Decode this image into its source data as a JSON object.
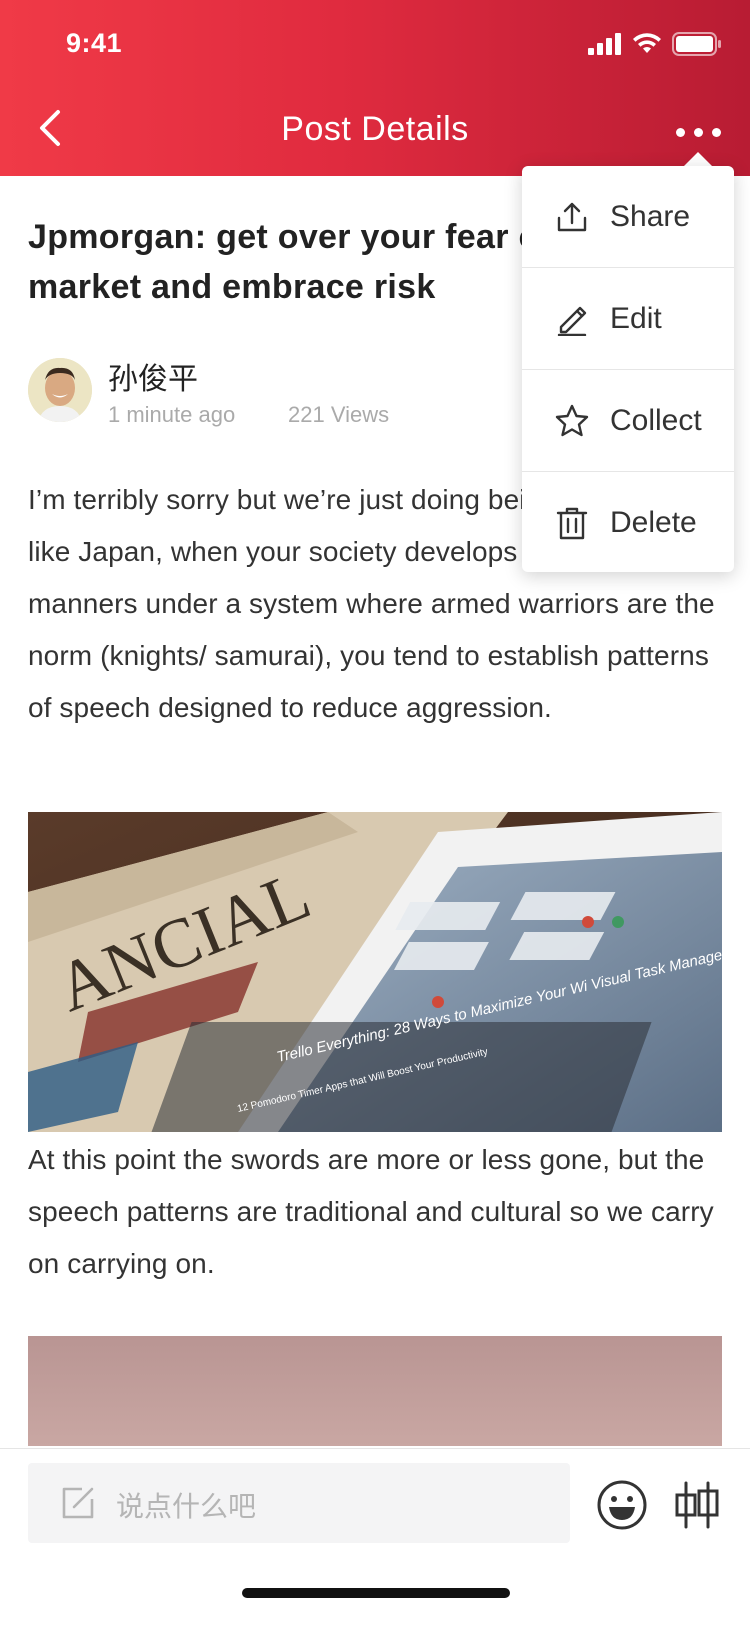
{
  "status_bar": {
    "time": "9:41"
  },
  "nav": {
    "title": "Post Details"
  },
  "post": {
    "title": "Jpmorgan: get over your fear of the stock market and embrace risk",
    "author": "孙俊平",
    "time_ago": "1 minute ago",
    "views": "221 Views",
    "paragraph_1": "I’m terribly sorry but we’re just doing being polite. Much like Japan, when your society develops it’s sense of manners under a system where armed warriors are the norm (knights/ samurai), you tend to establish patterns of speech designed to reduce aggression.",
    "paragraph_2": "At this point the swords are more or less gone, but the speech patterns are traditional and cultural so we carry on carrying on.",
    "image_1": {
      "newspaper_text": "ANCIAL",
      "screen_headline": "Trello Everything: 28 Ways to Maximize Your Wi Visual Task Management Tool",
      "screen_byline": "12 Pomodoro Timer Apps that Will Boost Your Productivity"
    }
  },
  "menu": {
    "items": [
      {
        "label": "Share",
        "icon": "share-icon"
      },
      {
        "label": "Edit",
        "icon": "edit-icon"
      },
      {
        "label": "Collect",
        "icon": "star-icon"
      },
      {
        "label": "Delete",
        "icon": "trash-icon"
      }
    ]
  },
  "bottom_bar": {
    "comment_placeholder": "说点什么吧",
    "icons": [
      "edit-note-icon",
      "emoji-icon",
      "compare-icon"
    ]
  },
  "colors": {
    "header_start": "#f03a47",
    "header_end": "#b81c33",
    "text_primary": "#333333",
    "text_muted": "#aaaaaa"
  }
}
